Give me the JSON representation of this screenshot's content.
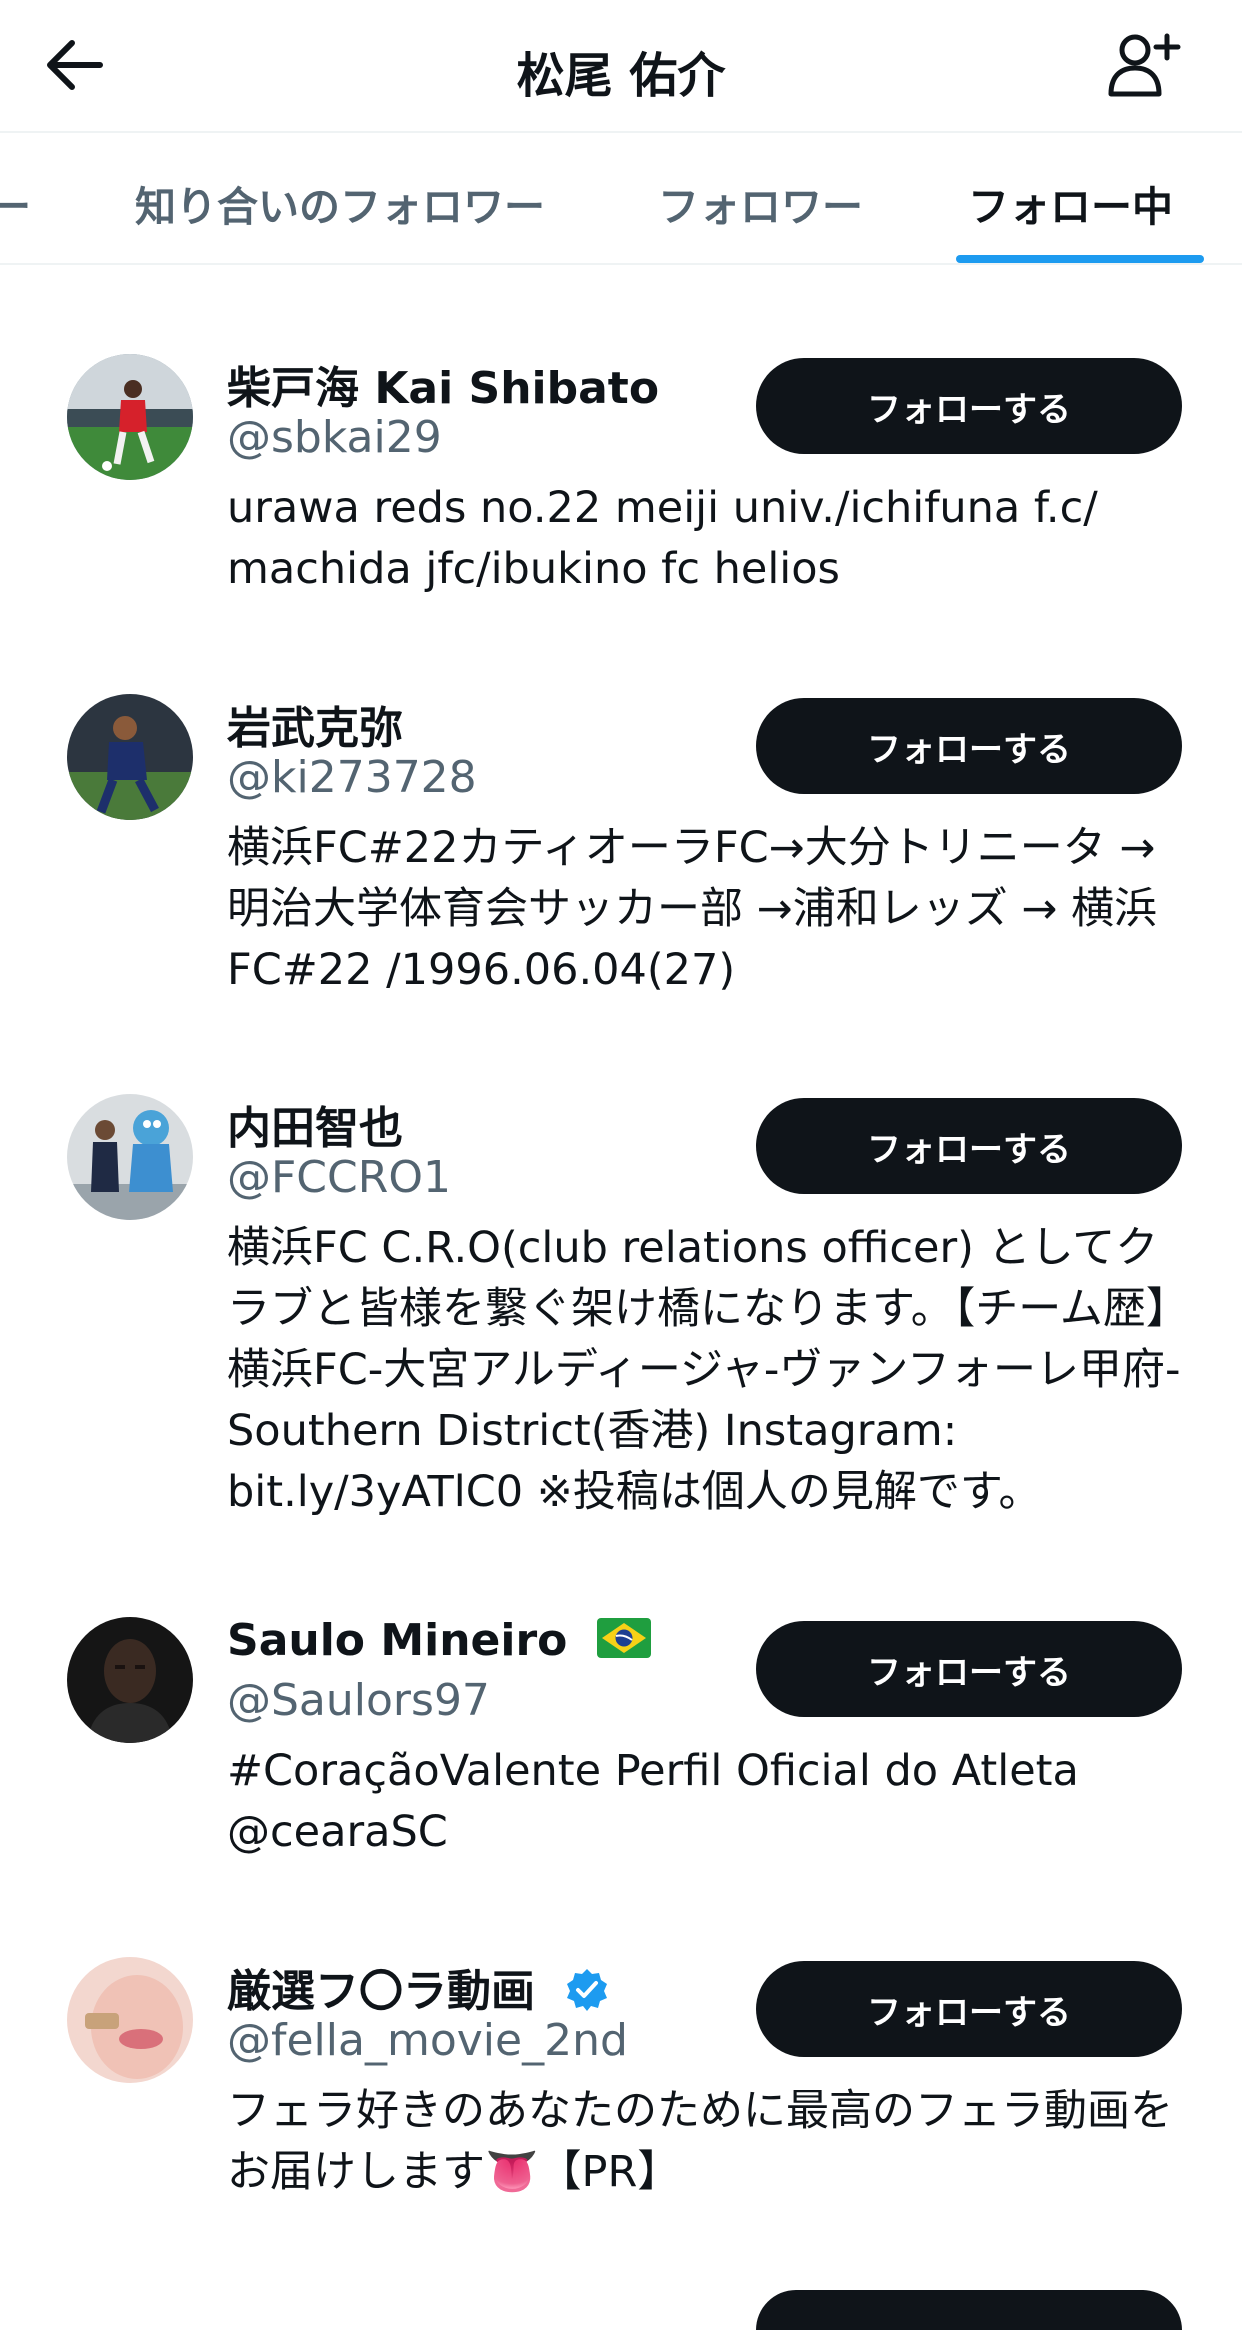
{
  "header": {
    "title": "松尾 佑介",
    "back_icon": "arrow-left-icon",
    "add_icon": "add-user-icon"
  },
  "tabs": [
    {
      "label": "ー"
    },
    {
      "label": "知り合いのフォロワー"
    },
    {
      "label": "フォロワー"
    },
    {
      "label": "フォロー中",
      "active": true
    }
  ],
  "colors": {
    "accent": "#1d9bf0",
    "button_bg": "#0f1419",
    "secondary_text": "#536471",
    "verified": "#1d9bf0"
  },
  "users": [
    {
      "name": "柴戸海 Kai Shibato",
      "handle": "@sbkai29",
      "bio": "urawa reds no.22 meiji univ./ichifuna f.c/ machida jfc/ibukino fc helios",
      "button": "フォローする"
    },
    {
      "name": "岩武克弥",
      "handle": "@ki273728",
      "bio": "横浜FC#22カティオーラFC→大分トリニータ → 明治大学体育会サッカー部 →浦和レッズ → 横浜FC#22 /1996.06.04(27)",
      "button": "フォローする"
    },
    {
      "name": "内田智也",
      "handle": "@FCCRO1",
      "bio": "横浜FC C.R.O(club relations officer) としてクラブと皆様を繋ぐ架け橋になります。【チーム歴】横浜FC-大宮アルディージャ-ヴァンフォーレ甲府-Southern District(香港) Instagram: bit.ly/3yATlC0 ※投稿は個人の見解です。",
      "button": "フォローする"
    },
    {
      "name": "Saulo Mineiro",
      "name_icon": "brazil-flag-icon",
      "handle": "@Saulors97",
      "bio": "#CoraçãoValente Perfil Oficial do Atleta @cearaSC",
      "button": "フォローする"
    },
    {
      "name": "厳選フ〇ラ動画",
      "name_icon": "verified-badge-icon",
      "handle": "@fella_movie_2nd",
      "bio": "フェラ好きのあなたのために最高のフェラ動画をお届けします👅【PR】",
      "button": "フォローする"
    }
  ]
}
